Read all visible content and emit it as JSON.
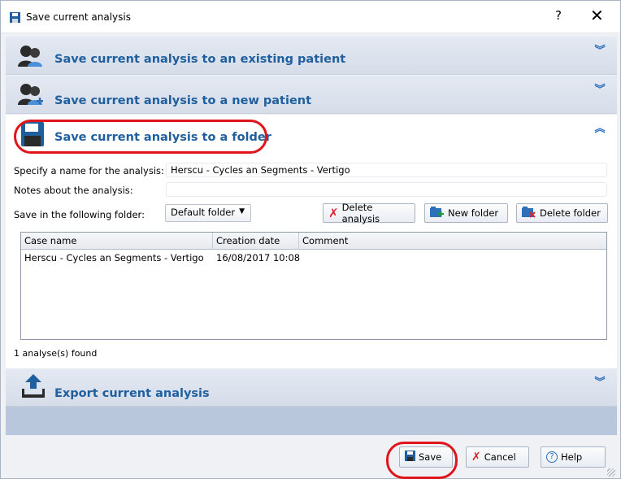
{
  "window": {
    "title": "Save current analysis",
    "help_label": "?",
    "close_label": "✕"
  },
  "sections": {
    "existing_patient": "Save current analysis to an existing patient",
    "new_patient": "Save current analysis to a new patient",
    "folder": "Save current analysis to a folder",
    "export": "Export current analysis"
  },
  "form": {
    "name_label": "Specify a name for the analysis:",
    "name_value": "Herscu - Cycles an Segments - Vertigo",
    "notes_label": "Notes about the analysis:",
    "notes_value": "",
    "folder_label": "Save in the following folder:",
    "folder_value": "Default folder"
  },
  "buttons": {
    "delete_analysis": "Delete analysis",
    "new_folder": "New folder",
    "delete_folder": "Delete folder",
    "save": "Save",
    "cancel": "Cancel",
    "help": "Help"
  },
  "table": {
    "headers": [
      "Case name",
      "Creation date",
      "Comment"
    ],
    "rows": [
      [
        "Herscu - Cycles an Segments - Vertigo",
        "16/08/2017 10:08",
        ""
      ]
    ]
  },
  "status": "1 analyse(s) found",
  "colors": {
    "accent": "#1f5f9e",
    "annotation": "#e0141b",
    "delete_red": "#d7262b"
  }
}
